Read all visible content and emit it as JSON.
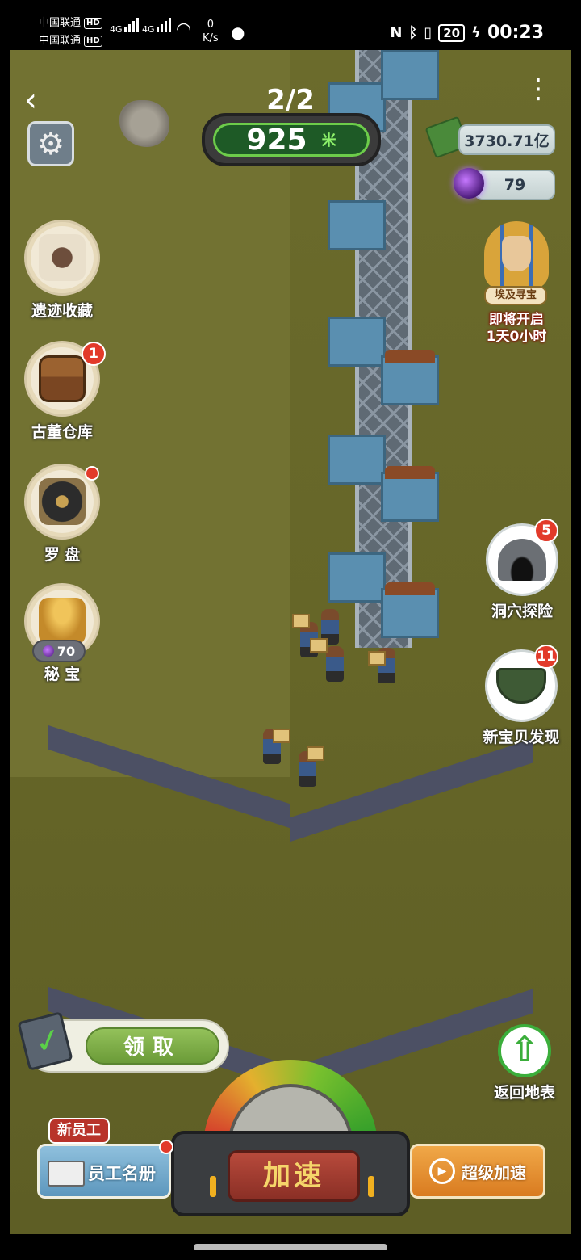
{
  "status_bar": {
    "carrier_1": "中国联通",
    "carrier_2": "中国联通",
    "hd_badge": "HD",
    "network_type": "4G",
    "speed_value": "0",
    "speed_unit": "K/s",
    "battery": "20",
    "time": "00:23"
  },
  "header": {
    "page_indicator": "2/2",
    "depth_value": "925",
    "depth_unit": "米"
  },
  "currency": {
    "money": "3730.71亿",
    "gems": "79"
  },
  "event": {
    "name": "埃及寻宝",
    "status_line_1": "即将开启",
    "status_line_2": "1天0小时"
  },
  "left_menu": {
    "relics": {
      "label": "遗迹收藏",
      "icon": "fossil-icon"
    },
    "antique_warehouse": {
      "label": "古董仓库",
      "icon": "treasure-chest-icon",
      "badge": "1"
    },
    "compass": {
      "label": "罗 盘",
      "icon": "compass-icon"
    },
    "secret_treasure": {
      "label": "秘 宝",
      "icon": "buddha-statue-icon",
      "cost": "70"
    }
  },
  "right_menu": {
    "cave": {
      "label": "洞穴探险",
      "icon": "cave-icon",
      "badge": "5"
    },
    "new_discovery": {
      "label": "新宝贝发现",
      "icon": "pot-icon",
      "badge": "11"
    }
  },
  "bottom": {
    "claim_label": "领取",
    "return_surface_label": "返回地表",
    "speed_up_label": "加速",
    "new_staff_tag": "新员工",
    "staff_roster_label": "员工名册",
    "super_speed_label": "超级加速"
  },
  "colors": {
    "ground": "#6b6b2c",
    "claim_green": "#7aab46",
    "badge_red": "#e23a2a",
    "super_orange": "#e69034",
    "speed_red": "#a33c30"
  }
}
